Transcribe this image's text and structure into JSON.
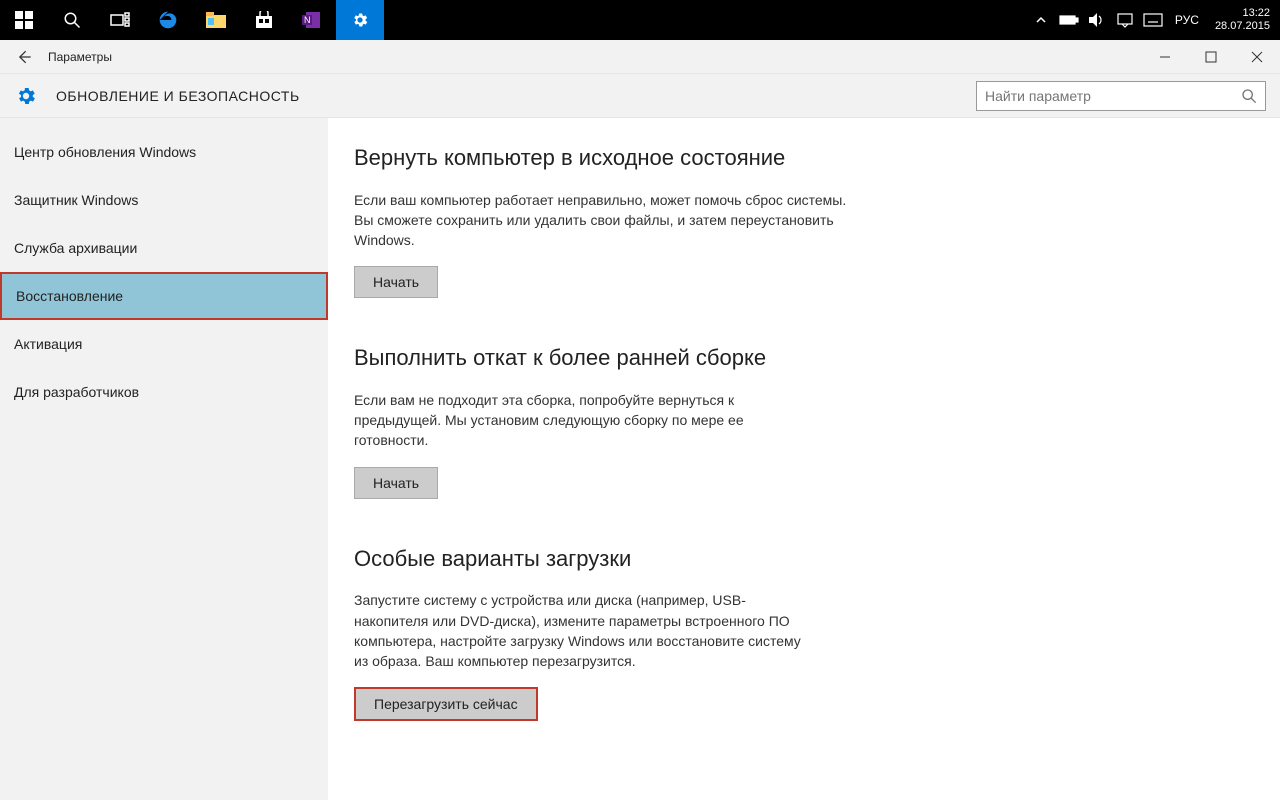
{
  "taskbar": {
    "lang": "РУС",
    "time": "13:22",
    "date": "28.07.2015"
  },
  "window": {
    "title": "Параметры",
    "header_title": "ОБНОВЛЕНИЕ И БЕЗОПАСНОСТЬ",
    "search_placeholder": "Найти параметр"
  },
  "sidebar": {
    "items": [
      {
        "label": "Центр обновления Windows"
      },
      {
        "label": "Защитник Windows"
      },
      {
        "label": "Служба архивации"
      },
      {
        "label": "Восстановление"
      },
      {
        "label": "Активация"
      },
      {
        "label": "Для разработчиков"
      }
    ]
  },
  "sections": {
    "reset": {
      "title": "Вернуть компьютер в исходное состояние",
      "text": "Если ваш компьютер работает неправильно, может помочь сброс системы. Вы сможете сохранить или удалить свои файлы, и затем переустановить Windows.",
      "button": "Начать"
    },
    "rollback": {
      "title": "Выполнить откат к более ранней сборке",
      "text": "Если вам не подходит эта сборка, попробуйте вернуться к предыдущей. Мы установим следующую сборку по мере ее готовности.",
      "button": "Начать"
    },
    "advanced": {
      "title": "Особые варианты загрузки",
      "text": "Запустите систему с устройства или диска (например, USB-накопителя или DVD-диска), измените параметры встроенного ПО компьютера, настройте загрузку Windows или восстановите систему из образа. Ваш компьютер перезагрузится.",
      "button": "Перезагрузить сейчас"
    }
  }
}
